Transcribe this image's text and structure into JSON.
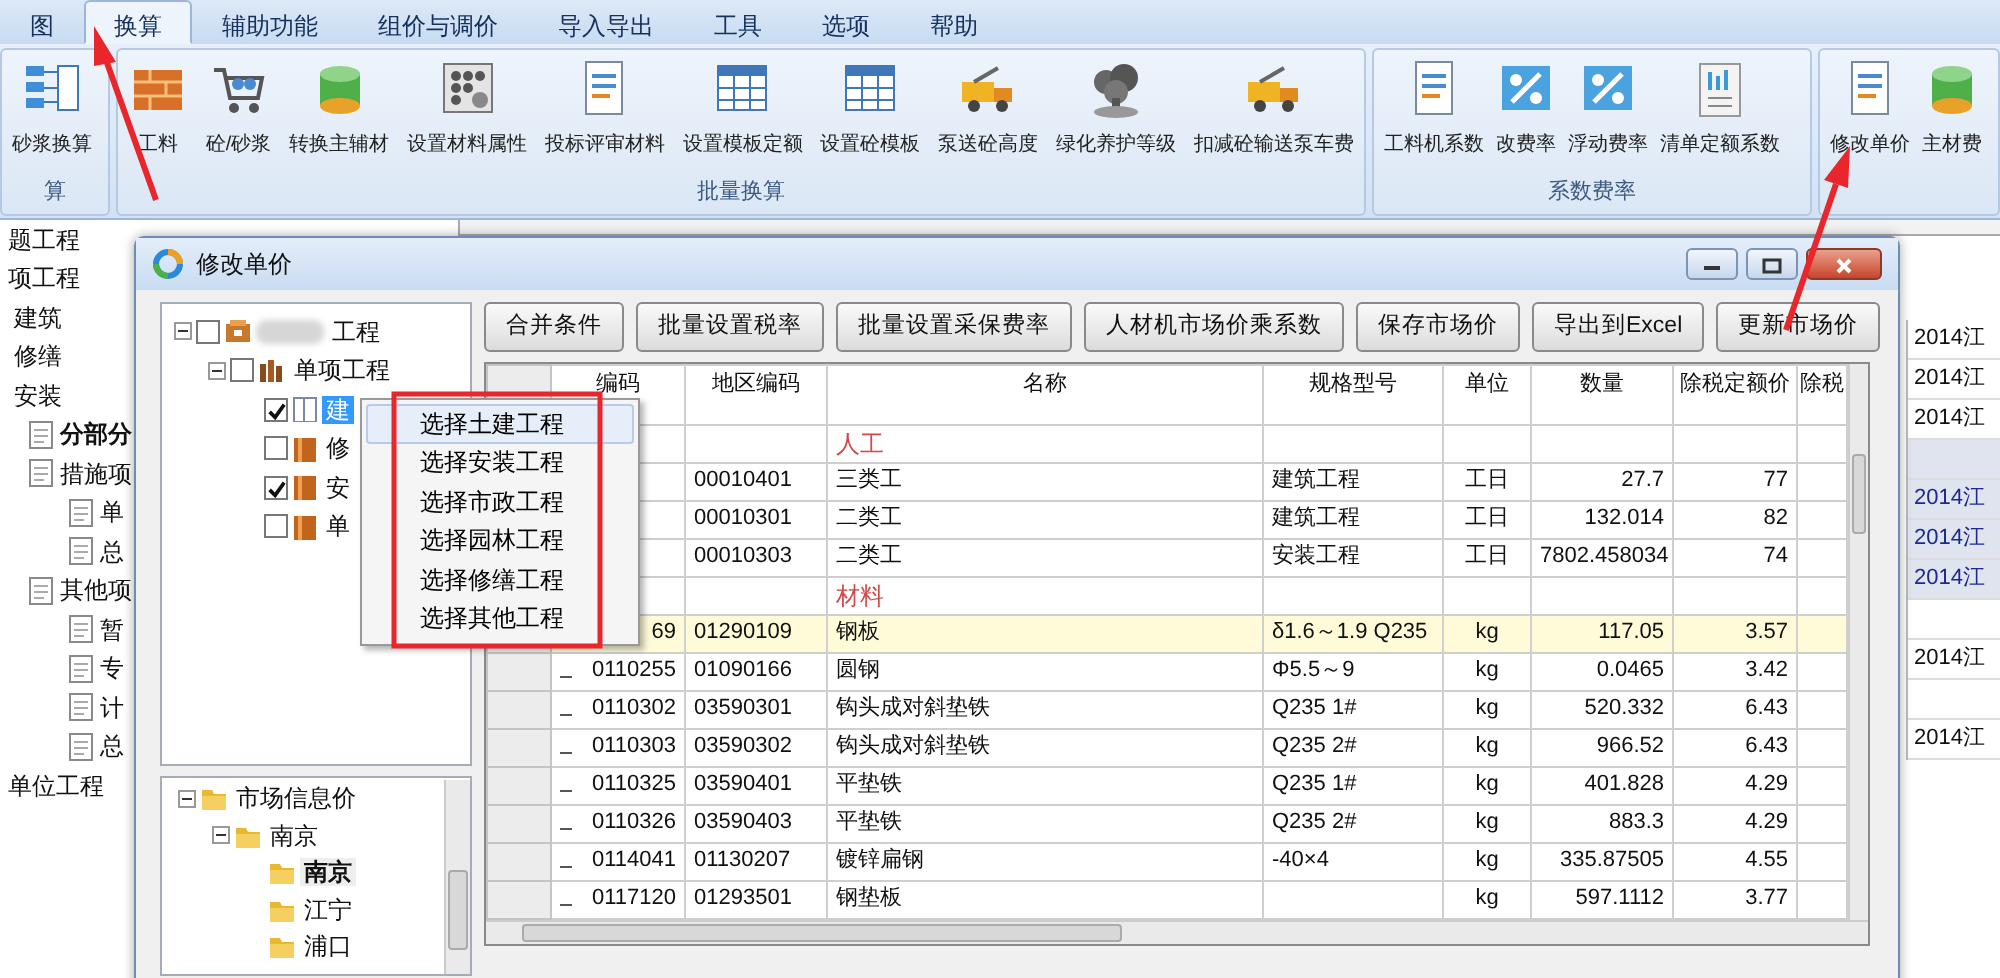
{
  "menu_tabs": [
    {
      "label": "图",
      "selected": false
    },
    {
      "label": "换算",
      "selected": true
    },
    {
      "label": "辅助功能",
      "selected": false
    },
    {
      "label": "组价与调价",
      "selected": false
    },
    {
      "label": "导入导出",
      "selected": false
    },
    {
      "label": "工具",
      "selected": false
    },
    {
      "label": "选项",
      "selected": false
    },
    {
      "label": "帮助",
      "selected": false
    }
  ],
  "ribbon_groups": [
    {
      "label": "算",
      "buttons": [
        "砂浆换算"
      ]
    },
    {
      "label": "批量换算",
      "buttons": [
        "工料",
        "砼/砂浆",
        "转换主辅材",
        "设置材料属性",
        "投标评审材料",
        "设置模板定额",
        "设置砼模板",
        "泵送砼高度",
        "绿化养护等级",
        "扣减砼输送泵车费"
      ]
    },
    {
      "label": "系数费率",
      "buttons": [
        "工料机系数",
        "改费率",
        "浮动费率",
        "清单定额系数"
      ]
    },
    {
      "buttons": [
        "修改单价",
        "主材费"
      ]
    }
  ],
  "project_tree": [
    {
      "label": "题工程",
      "kind": "plain",
      "selected": false
    },
    {
      "label": "项工程",
      "kind": "plain",
      "selected": false,
      "children": [
        {
          "label": "建筑",
          "kind": "plain",
          "selected": false
        },
        {
          "label": "修缮",
          "kind": "plain",
          "selected": false
        },
        {
          "label": "安装",
          "kind": "plain",
          "selected": false
        }
      ]
    },
    {
      "label": "分部分",
      "kind": "document",
      "selected": true
    },
    {
      "label": "措施项",
      "kind": "document",
      "selected": false,
      "children": [
        {
          "label": "单",
          "kind": "document",
          "selected": false
        },
        {
          "label": "总",
          "kind": "document",
          "selected": false
        }
      ]
    },
    {
      "label": "其他项",
      "kind": "document",
      "selected": false,
      "children": [
        {
          "label": "暂",
          "kind": "document",
          "selected": false
        },
        {
          "label": "专",
          "kind": "document",
          "selected": false
        },
        {
          "label": "计",
          "kind": "document",
          "selected": false
        },
        {
          "label": "总",
          "kind": "document",
          "selected": false
        }
      ]
    },
    {
      "label": "单位工程",
      "kind": "plain",
      "selected": false
    }
  ],
  "background_cells": [
    {
      "text": "2014江",
      "highlighted": false
    },
    {
      "text": "2014江",
      "highlighted": false
    },
    {
      "text": "2014江",
      "highlighted": false
    },
    {
      "highlighted": true
    },
    {
      "text": "2014江",
      "highlighted": true
    },
    {
      "text": "2014江",
      "highlighted": true
    },
    {
      "text": "2014江",
      "highlighted": true
    },
    {
      "highlighted": false
    },
    {
      "text": "2014江",
      "highlighted": false
    },
    {
      "highlighted": false
    },
    {
      "text": "2014江",
      "highlighted": false
    }
  ],
  "dialog": {
    "title": "修改单价",
    "project_tree": [
      {
        "label": "工程",
        "checked": false,
        "selected": false,
        "children": [
          {
            "label": "单项工程",
            "checked": false,
            "selected": false,
            "children": [
              {
                "label": "建",
                "checked": true,
                "selected": true
              },
              {
                "label": "修",
                "checked": false,
                "selected": false
              },
              {
                "label": "安",
                "checked": true,
                "selected": false
              },
              {
                "label": "单",
                "checked": false,
                "selected": false
              }
            ]
          }
        ]
      }
    ],
    "context_menu": [
      {
        "label": "选择土建工程",
        "selected": true
      },
      {
        "label": "选择安装工程",
        "selected": false
      },
      {
        "label": "选择市政工程",
        "selected": false
      },
      {
        "label": "选择园林工程",
        "selected": false
      },
      {
        "label": "选择修缮工程",
        "selected": false
      },
      {
        "label": "选择其他工程",
        "selected": false
      }
    ],
    "market_tree": [
      {
        "label": "市场信息价",
        "selected": false,
        "children": [
          {
            "label": "南京",
            "selected": false,
            "children": [
              {
                "label": "南京",
                "selected": true
              },
              {
                "label": "江宁",
                "selected": false
              },
              {
                "label": "浦口",
                "selected": false
              }
            ]
          }
        ]
      }
    ],
    "toolbar_buttons": [
      "合并条件",
      "批量设置税率",
      "批量设置采保费率",
      "人材机市场价乘系数",
      "保存市场价",
      "导出到Excel",
      "更新市场价"
    ],
    "grid": {
      "columns": [
        "编码",
        "地区编码",
        "名称",
        "规格型号",
        "单位",
        "数量",
        "除税定额价",
        "除税"
      ],
      "rows": [
        {
          "kind": "group",
          "name": "人工",
          "selected": false
        },
        {
          "kind": "item",
          "region_code": "00010401",
          "name": "三类工",
          "spec": "建筑工程",
          "unit": "工日",
          "quantity": "27.7",
          "price": "77",
          "selected": false
        },
        {
          "kind": "item",
          "region_code": "00010301",
          "name": "二类工",
          "spec": "建筑工程",
          "unit": "工日",
          "quantity": "132.014",
          "price": "82",
          "selected": false
        },
        {
          "kind": "item",
          "region_code": "00010303",
          "name": "二类工",
          "spec": "安装工程",
          "unit": "工日",
          "quantity": "7802.458034",
          "price": "74",
          "selected": false
        },
        {
          "kind": "group",
          "name": "材料",
          "selected": false
        },
        {
          "kind": "item",
          "code": "69",
          "region_code": "01290109",
          "name": "钢板",
          "spec": "δ1.6～1.9 Q235",
          "unit": "kg",
          "quantity": "117.05",
          "price": "3.57",
          "selected": true
        },
        {
          "kind": "item",
          "code": "0110255",
          "region_code": "01090166",
          "name": "圆钢",
          "spec": "Φ5.5～9",
          "unit": "kg",
          "quantity": "0.0465",
          "price": "3.42",
          "selected": false
        },
        {
          "kind": "item",
          "code": "0110302",
          "region_code": "03590301",
          "name": "钩头成对斜垫铁",
          "spec": "Q235 1#",
          "unit": "kg",
          "quantity": "520.332",
          "price": "6.43",
          "selected": false
        },
        {
          "kind": "item",
          "code": "0110303",
          "region_code": "03590302",
          "name": "钩头成对斜垫铁",
          "spec": "Q235 2#",
          "unit": "kg",
          "quantity": "966.52",
          "price": "6.43",
          "selected": false
        },
        {
          "kind": "item",
          "code": "0110325",
          "region_code": "03590401",
          "name": "平垫铁",
          "spec": "Q235 1#",
          "unit": "kg",
          "quantity": "401.828",
          "price": "4.29",
          "selected": false
        },
        {
          "kind": "item",
          "code": "0110326",
          "region_code": "03590403",
          "name": "平垫铁",
          "spec": "Q235 2#",
          "unit": "kg",
          "quantity": "883.3",
          "price": "4.29",
          "selected": false
        },
        {
          "kind": "item",
          "code": "0114041",
          "region_code": "01130207",
          "name": "镀锌扁钢",
          "spec": "-40×4",
          "unit": "kg",
          "quantity": "335.87505",
          "price": "4.55",
          "selected": false
        },
        {
          "kind": "item",
          "code": "0117120",
          "region_code": "01293501",
          "name": "钢垫板",
          "unit": "kg",
          "quantity": "597.1112",
          "price": "3.77",
          "selected": false
        }
      ]
    }
  }
}
